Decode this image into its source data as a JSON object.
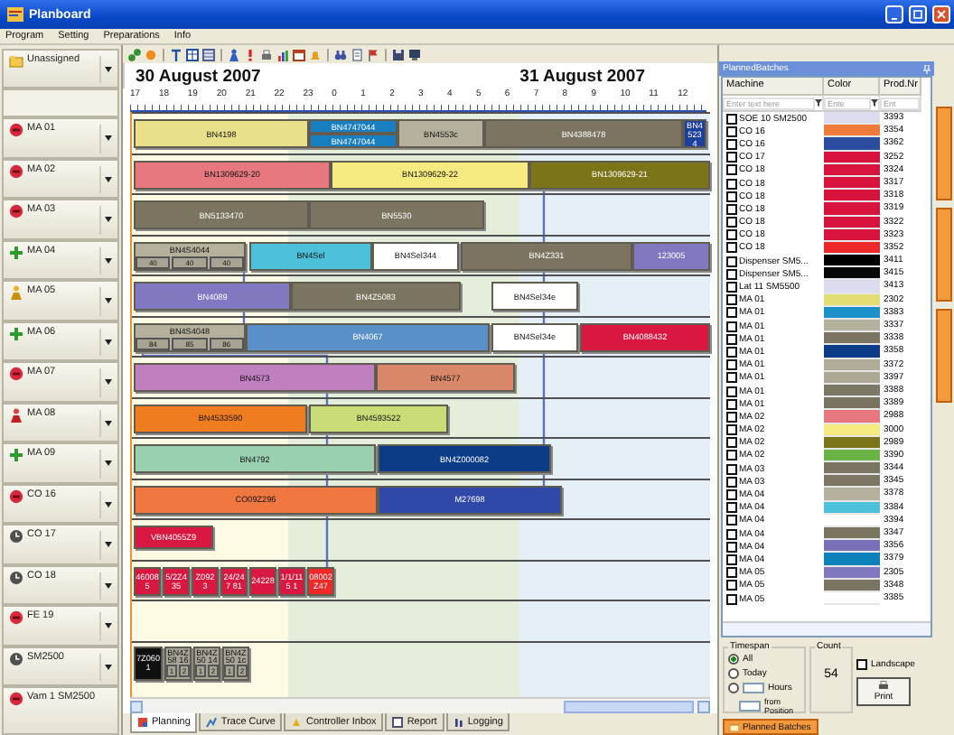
{
  "window": {
    "title": "Planboard"
  },
  "menu": [
    "Program",
    "Setting",
    "Preparations",
    "Info"
  ],
  "machines": [
    {
      "name": "Unassigned",
      "kind": "unassigned"
    },
    {
      "name": "MA 01",
      "kind": "stopped"
    },
    {
      "name": "MA 02",
      "kind": "stopped"
    },
    {
      "name": "MA 03",
      "kind": "stopped"
    },
    {
      "name": "MA 04",
      "kind": "running"
    },
    {
      "name": "MA 05",
      "kind": "setup"
    },
    {
      "name": "MA 06",
      "kind": "running"
    },
    {
      "name": "MA 07",
      "kind": "stopped"
    },
    {
      "name": "MA 08",
      "kind": "alarm"
    },
    {
      "name": "MA 09",
      "kind": "running"
    },
    {
      "name": "CO 16",
      "kind": "stopped"
    },
    {
      "name": "CO 17",
      "kind": "idle"
    },
    {
      "name": "CO 18",
      "kind": "idle"
    },
    {
      "name": "FE 19",
      "kind": "stopped"
    },
    {
      "name": "SM2500",
      "kind": "idle"
    },
    {
      "name": "Vam 1 SM2500",
      "kind": "stopped"
    }
  ],
  "gantt": {
    "dates": [
      "30 August 2007",
      "31 August 2007"
    ],
    "hours": [
      "17",
      "18",
      "19",
      "20",
      "21",
      "22",
      "23",
      "0",
      "1",
      "2",
      "3",
      "4",
      "5",
      "6",
      "7",
      "8",
      "9",
      "10",
      "11",
      "12"
    ],
    "rows": [
      {
        "bars": [
          {
            "label": "BN4198",
            "color": "#e8e08a"
          },
          {
            "label": "BN4747044",
            "color": "#1a7fc0"
          },
          {
            "label": "BN4747044",
            "color": "#1a7fc0"
          },
          {
            "label": "BN4553c",
            "color": "#b4b09c"
          },
          {
            "label": "BN4388478",
            "color": "#7a7460"
          },
          {
            "label": "BN4523 4",
            "color": "#1c3f9c"
          }
        ]
      },
      {
        "bars": [
          {
            "label": "BN1309629-20",
            "color": "#e87880"
          },
          {
            "label": "BN1309629-22",
            "color": "#f4ea80"
          },
          {
            "label": "BN1309629-21",
            "color": "#7c7418"
          }
        ]
      },
      {
        "bars": [
          {
            "label": "BN5133470",
            "color": "#7a7460"
          },
          {
            "label": "BN5530",
            "color": "#7a7460"
          }
        ]
      },
      {
        "bars": [
          {
            "label": "BN4S4044",
            "color": "#b4b09c",
            "subs": [
              "40",
              "40",
              "40"
            ]
          },
          {
            "label": "BN4Sel",
            "color": "#4cc0d8"
          },
          {
            "label": "BN4Sel344",
            "color": "#ffffff"
          },
          {
            "label": "BN4Z331",
            "color": "#7a7460"
          },
          {
            "label": "123005",
            "color": "#8078c0"
          }
        ]
      },
      {
        "bars": [
          {
            "label": "BN4089",
            "color": "#8078c0"
          },
          {
            "label": "BN4Z5083",
            "color": "#7a7460"
          },
          {
            "label": "BN4Sel34e",
            "color": "#ffffff"
          }
        ]
      },
      {
        "bars": [
          {
            "label": "BN4S4048",
            "color": "#b4b09c",
            "subs": [
              "84",
              "85",
              "86"
            ]
          },
          {
            "label": "BN4067",
            "color": "#5a90c8"
          },
          {
            "label": "BN4Sel34e",
            "color": "#ffffff"
          },
          {
            "label": "BN4088432",
            "color": "#d81840"
          }
        ]
      },
      {
        "bars": [
          {
            "label": "BN4573",
            "color": "#c080c0"
          },
          {
            "label": "BN4577",
            "color": "#d88868"
          }
        ]
      },
      {
        "bars": [
          {
            "label": "BN4533590",
            "color": "#f07c20"
          },
          {
            "label": "BN4593522",
            "color": "#c8dc78"
          }
        ]
      },
      {
        "bars": [
          {
            "label": "BN4792",
            "color": "#98d0b0"
          },
          {
            "label": "BN4Z000082",
            "color": "#0c3c88"
          }
        ]
      },
      {
        "bars": [
          {
            "label": "CO09Z296",
            "color": "#f07840"
          },
          {
            "label": "M27698",
            "color": "#3048a8"
          }
        ]
      },
      {
        "bars": [
          {
            "label": "VBN4055Z9",
            "color": "#d81840"
          }
        ]
      },
      {
        "bars": [
          {
            "label": "46008 5",
            "color": "#d81840"
          },
          {
            "label": "5/2Z4 35",
            "color": "#d81840"
          },
          {
            "label": "Z0923",
            "color": "#d81840"
          },
          {
            "label": "24/247 81",
            "color": "#d81840"
          },
          {
            "label": "24228",
            "color": "#d81840"
          },
          {
            "label": "1/1/115 1",
            "color": "#d81840"
          },
          {
            "label": "08002 Z47",
            "color": "#f02828"
          }
        ]
      },
      {
        "bars": []
      },
      {
        "bars": [
          {
            "label": "7Z060 1",
            "color": "#101010"
          },
          {
            "label": "BN4Z58 16",
            "color": "#a8a498",
            "subs": [
              "1",
              "2"
            ]
          },
          {
            "label": "BN4Z50 14",
            "color": "#a8a498",
            "subs": [
              "1",
              "2"
            ]
          },
          {
            "label": "BN4Z50 1c",
            "color": "#a8a498",
            "subs": [
              "1",
              "2"
            ]
          }
        ]
      }
    ]
  },
  "bottom_tabs": [
    {
      "label": "Planning",
      "selected": true
    },
    {
      "label": "Trace Curve",
      "selected": false
    },
    {
      "label": "Controller Inbox",
      "selected": false
    },
    {
      "label": "Report",
      "selected": false
    },
    {
      "label": "Logging",
      "selected": false
    }
  ],
  "batches": {
    "title": "PlannedBatches",
    "columns": [
      "Machine",
      "Color",
      "Prod.Nr"
    ],
    "filters": [
      {
        "placeholder": "Enter text here"
      },
      {
        "placeholder": "Ente"
      },
      {
        "placeholder": "Ent"
      }
    ],
    "rows": [
      {
        "machine": "SOE 10 SM2500",
        "color": "#dcdcf0",
        "prodnr": "3393",
        "checked": false
      },
      {
        "machine": "CO 16",
        "color": "#f07c3c",
        "prodnr": "3354",
        "checked": false
      },
      {
        "machine": "CO 16",
        "color": "#2c4ca0",
        "prodnr": "3362",
        "checked": false
      },
      {
        "machine": "CO 17",
        "color": "#d8143c",
        "prodnr": "3252",
        "checked": false
      },
      {
        "machine": "CO 18",
        "color": "#d8143c",
        "prodnr": "3324",
        "checked": false
      },
      {
        "machine": "CO 18",
        "color": "#d8143c",
        "prodnr": "3317",
        "checked": false
      },
      {
        "machine": "CO 18",
        "color": "#d8143c",
        "prodnr": "3318",
        "checked": false
      },
      {
        "machine": "CO 18",
        "color": "#d8143c",
        "prodnr": "3319",
        "checked": false
      },
      {
        "machine": "CO 18",
        "color": "#d8143c",
        "prodnr": "3322",
        "checked": false
      },
      {
        "machine": "CO 18",
        "color": "#d8143c",
        "prodnr": "3323",
        "checked": false
      },
      {
        "machine": "CO 18",
        "color": "#ec2828",
        "prodnr": "3352",
        "checked": false
      },
      {
        "machine": "Dispenser SM5...",
        "color": "#000000",
        "prodnr": "3411",
        "checked": false
      },
      {
        "machine": "Dispenser SM5...",
        "color": "#080808",
        "prodnr": "3415",
        "checked": false
      },
      {
        "machine": "Lat 11 SM5500",
        "color": "#dcdcf0",
        "prodnr": "3413",
        "checked": false
      },
      {
        "machine": "MA 01",
        "color": "#e4dc74",
        "prodnr": "2302",
        "checked": false
      },
      {
        "machine": "MA 01",
        "color": "#1c90c8",
        "prodnr": "3383",
        "checked": false
      },
      {
        "machine": "MA 01",
        "color": "#b4b09c",
        "prodnr": "3337",
        "checked": false
      },
      {
        "machine": "MA 01",
        "color": "#7a7460",
        "prodnr": "3338",
        "checked": false
      },
      {
        "machine": "MA 01",
        "color": "#0c3c88",
        "prodnr": "3358",
        "checked": false
      },
      {
        "machine": "MA 01",
        "color": "#b0ac98",
        "prodnr": "3372",
        "checked": false
      },
      {
        "machine": "MA 01",
        "color": "#aca894",
        "prodnr": "3397",
        "checked": false
      },
      {
        "machine": "MA 01",
        "color": "#7c7864",
        "prodnr": "3388",
        "checked": false
      },
      {
        "machine": "MA 01",
        "color": "#787460",
        "prodnr": "3389",
        "checked": false
      },
      {
        "machine": "MA 02",
        "color": "#e87880",
        "prodnr": "2988",
        "checked": false
      },
      {
        "machine": "MA 02",
        "color": "#f4ea80",
        "prodnr": "3000",
        "checked": false
      },
      {
        "machine": "MA 02",
        "color": "#7c7418",
        "prodnr": "2989",
        "checked": false
      },
      {
        "machine": "MA 02",
        "color": "#6cb448",
        "prodnr": "3390",
        "checked": false
      },
      {
        "machine": "MA 03",
        "color": "#7a7460",
        "prodnr": "3344",
        "checked": false
      },
      {
        "machine": "MA 03",
        "color": "#7c7662",
        "prodnr": "3345",
        "checked": false
      },
      {
        "machine": "MA 04",
        "color": "#b4b09c",
        "prodnr": "3378",
        "checked": false
      },
      {
        "machine": "MA 04",
        "color": "#4cc0d8",
        "prodnr": "3384",
        "checked": false
      },
      {
        "machine": "MA 04",
        "color": "#ffffff",
        "prodnr": "3394",
        "checked": false
      },
      {
        "machine": "MA 04",
        "color": "#7a7460",
        "prodnr": "3347",
        "checked": false
      },
      {
        "machine": "MA 04",
        "color": "#7870b8",
        "prodnr": "3356",
        "checked": false
      },
      {
        "machine": "MA 04",
        "color": "#0c80b8",
        "prodnr": "3379",
        "checked": false
      },
      {
        "machine": "MA 05",
        "color": "#8078c0",
        "prodnr": "2305",
        "checked": false
      },
      {
        "machine": "MA 05",
        "color": "#7a7460",
        "prodnr": "3348",
        "checked": false
      },
      {
        "machine": "MA 05",
        "color": "#fefefe",
        "prodnr": "3385",
        "checked": false
      }
    ],
    "timespan": {
      "title": "Timespan",
      "options": [
        {
          "label": "All",
          "selected": true
        },
        {
          "label": "Today",
          "selected": false
        },
        {
          "selected": false
        }
      ],
      "hours_label": "Hours",
      "from_label": "from Position"
    },
    "count": {
      "title": "Count",
      "value": "54"
    },
    "landscape": {
      "label": "Landscape",
      "checked": false
    },
    "print_label": "Print",
    "tab": "Planned Batches"
  }
}
